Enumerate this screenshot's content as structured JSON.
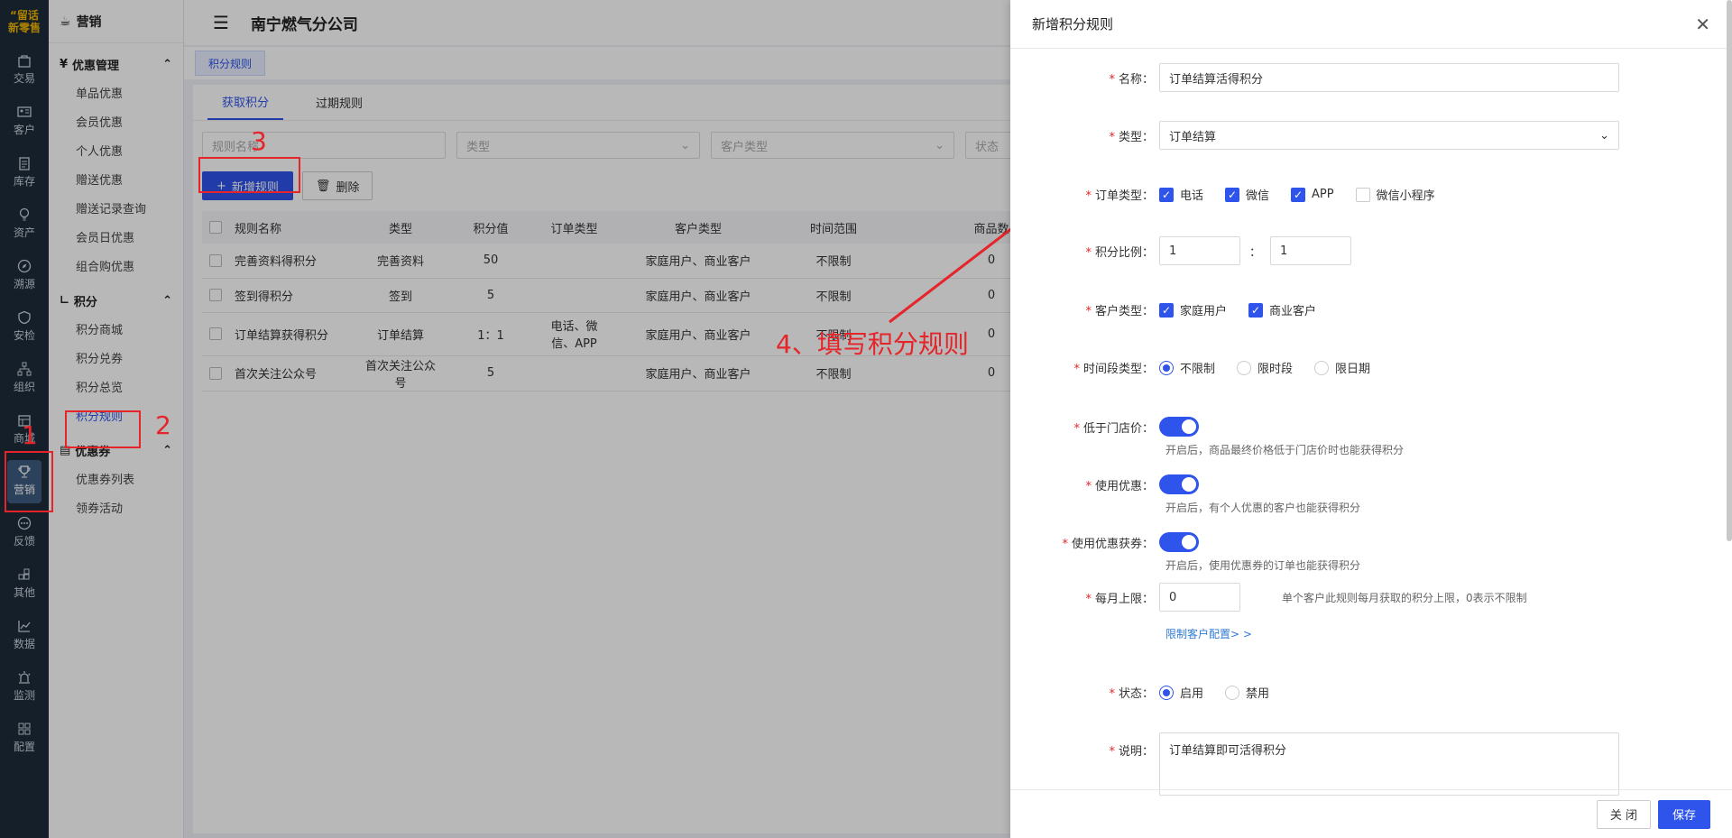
{
  "logo": {
    "line1": "“留话",
    "line2": "新零售"
  },
  "rail": [
    {
      "label": "交易",
      "icon": "bag-icon"
    },
    {
      "label": "客户",
      "icon": "id-card-icon"
    },
    {
      "label": "库存",
      "icon": "clipboard-icon"
    },
    {
      "label": "资产",
      "icon": "bulb-icon"
    },
    {
      "label": "溯源",
      "icon": "compass-icon"
    },
    {
      "label": "安检",
      "icon": "shield-icon"
    },
    {
      "label": "组织",
      "icon": "org-icon"
    },
    {
      "label": "商城",
      "icon": "store-icon"
    },
    {
      "label": "营销",
      "icon": "trophy-icon"
    },
    {
      "label": "反馈",
      "icon": "chat-icon"
    },
    {
      "label": "其他",
      "icon": "blocks-icon"
    },
    {
      "label": "数据",
      "icon": "chart-icon"
    },
    {
      "label": "监测",
      "icon": "alarm-icon"
    },
    {
      "label": "配置",
      "icon": "grid-icon"
    }
  ],
  "menu": {
    "title": "营销",
    "groups": [
      {
        "label": "优惠管理",
        "items": [
          "单品优惠",
          "会员优惠",
          "个人优惠",
          "赠送优惠",
          "赠送记录查询",
          "会员日优惠",
          "组合购优惠"
        ]
      },
      {
        "label": "积分",
        "items": [
          "积分商城",
          "积分兑券",
          "积分总览",
          "积分规则"
        ]
      },
      {
        "label": "优惠券",
        "items": [
          "优惠券列表",
          "领券活动"
        ]
      }
    ]
  },
  "topbar": {
    "title": "南宁燃气分公司"
  },
  "tag": "积分规则",
  "tabs": [
    "获取积分",
    "过期规则"
  ],
  "filters": {
    "name": "规则名称",
    "type": "类型",
    "customer_type": "客户类型",
    "status": "状态"
  },
  "actions": {
    "add": "新增规则",
    "delete": "删除"
  },
  "table": {
    "headers": [
      "规则名称",
      "类型",
      "积分值",
      "订单类型",
      "客户类型",
      "时间范围",
      "商品数"
    ],
    "rows": [
      [
        "完善资料得积分",
        "完善资料",
        "50",
        "",
        "家庭用户、商业客户",
        "不限制",
        "0"
      ],
      [
        "签到得积分",
        "签到",
        "5",
        "",
        "家庭用户、商业客户",
        "不限制",
        "0"
      ],
      [
        "订单结算获得积分",
        "订单结算",
        "1：1",
        "电话、微信、APP",
        "家庭用户、商业客户",
        "不限制",
        "0"
      ],
      [
        "首次关注公众号",
        "首次关注公众号",
        "5",
        "",
        "家庭用户、商业客户",
        "不限制",
        "0"
      ]
    ]
  },
  "annotations": {
    "n1": "1",
    "n2": "2",
    "n3": "3",
    "n4": "4、填写积分规则"
  },
  "drawer": {
    "title": "新增积分规则",
    "name_label": "名称：",
    "name_value": "订单结算活得积分",
    "type_label": "类型：",
    "type_value": "订单结算",
    "order_type_label": "订单类型：",
    "order_types": [
      "电话",
      "微信",
      "APP",
      "微信小程序"
    ],
    "ratio_label": "积分比例：",
    "ratio_left": "1",
    "ratio_sep": "：",
    "ratio_right": "1",
    "customer_type_label": "客户类型：",
    "customer_types": [
      "家庭用户",
      "商业客户"
    ],
    "period_label": "时间段类型：",
    "periods": [
      "不限制",
      "限时段",
      "限日期"
    ],
    "below_price_label": "低于门店价：",
    "below_price_hint": "开启后，商品最终价格低于门店价时也能获得积分",
    "use_discount_label": "使用优惠：",
    "use_discount_hint": "开启后，有个人优惠的客户也能获得积分",
    "use_coupon_label": "使用优惠获券：",
    "use_coupon_hint": "开启后，使用优惠券的订单也能获得积分",
    "monthly_label": "每月上限：",
    "monthly_value": "0",
    "monthly_hint": "单个客户此规则每月获取的积分上限，0表示不限制",
    "limit_link": "限制客户配置> >",
    "status_label": "状态：",
    "statuses": [
      "启用",
      "禁用"
    ],
    "desc_label": "说明：",
    "desc_value": "订单结算即可活得积分",
    "close_btn": "关 闭",
    "save_btn": "保存"
  },
  "colors": {
    "primary": "#2f54eb",
    "annotation_red": "#e5252a",
    "rail_bg": "#1d2b3a"
  }
}
